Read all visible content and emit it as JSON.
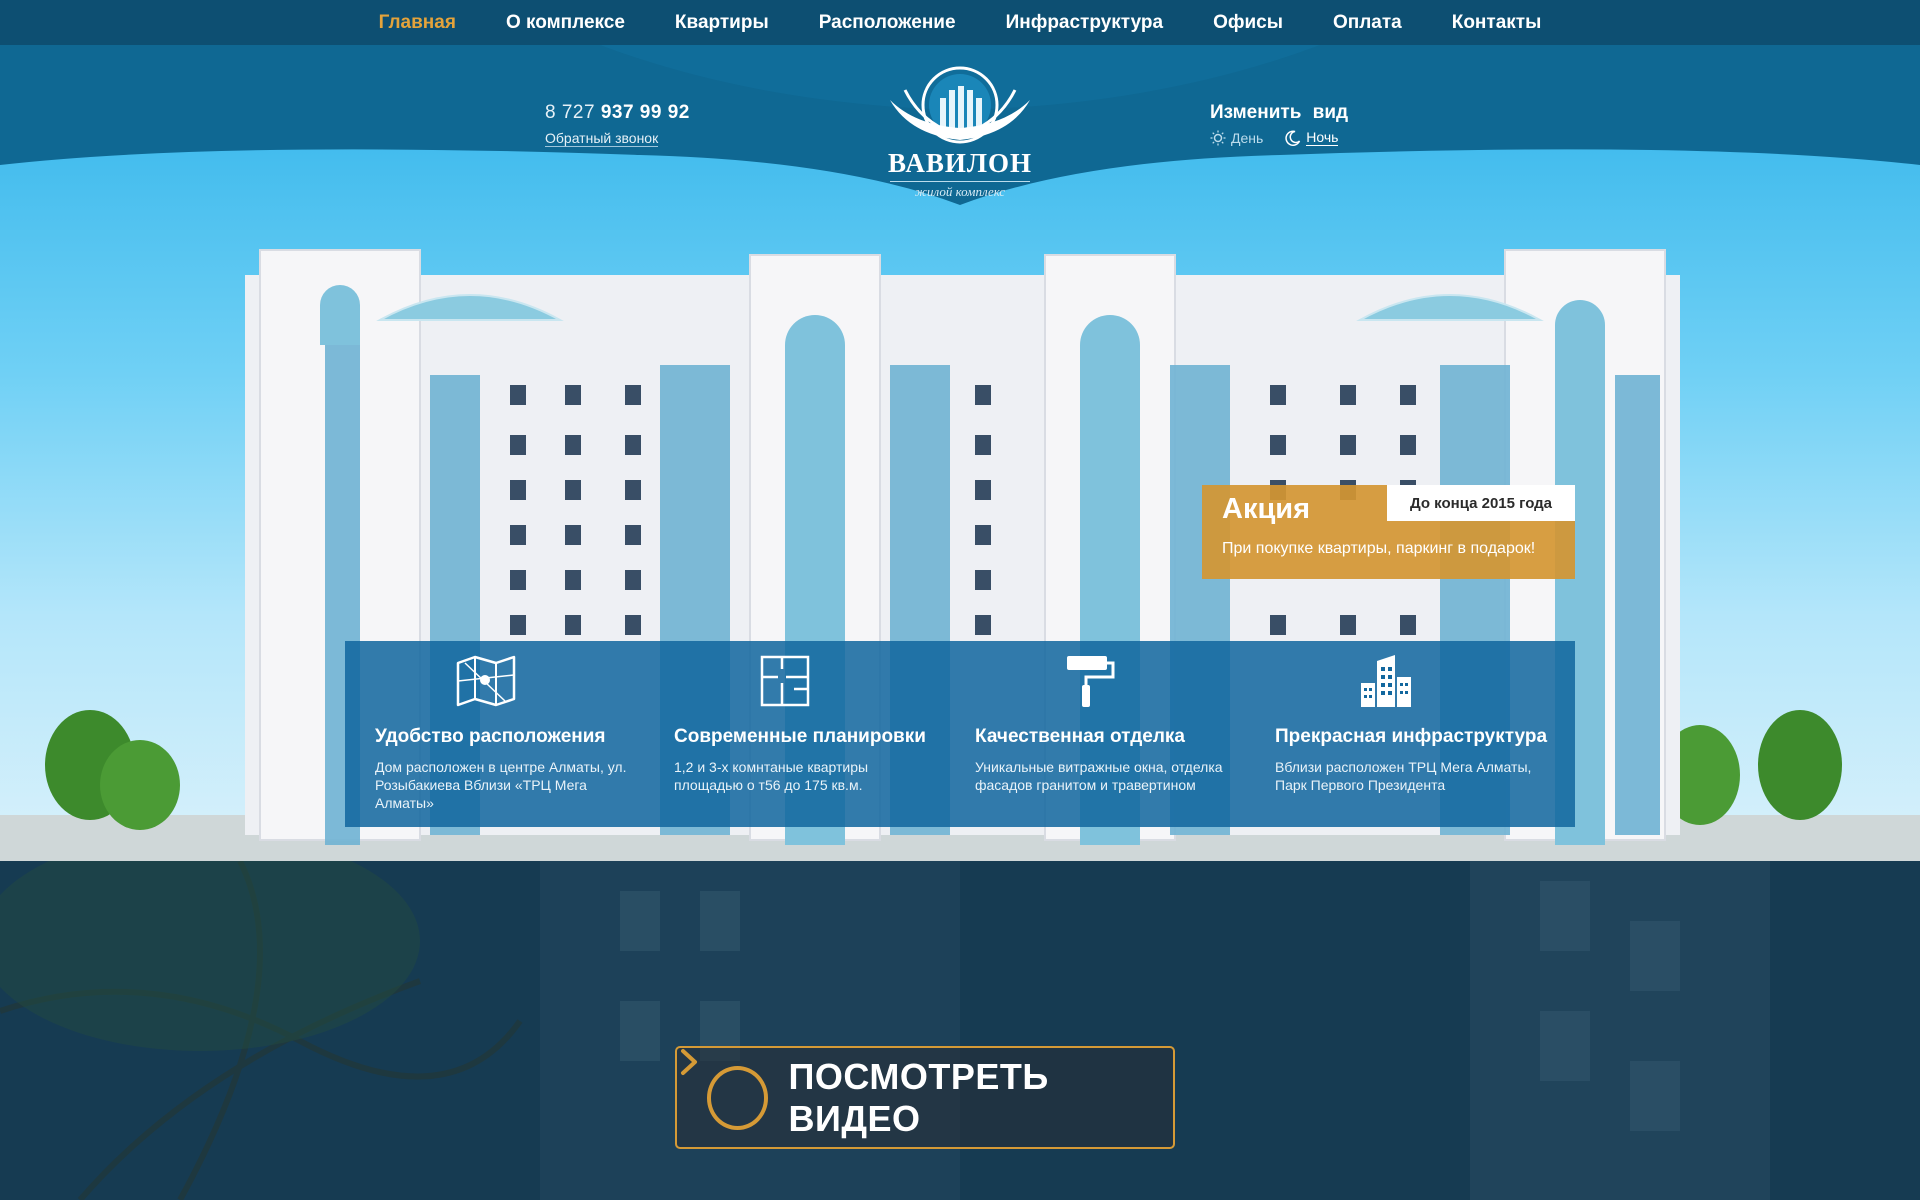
{
  "nav": {
    "items": [
      {
        "label": "Главная",
        "active": true
      },
      {
        "label": "О комплексе"
      },
      {
        "label": "Квартиры"
      },
      {
        "label": "Расположение"
      },
      {
        "label": "Инфраструктура"
      },
      {
        "label": "Офисы"
      },
      {
        "label": "Оплата"
      },
      {
        "label": "Контакты"
      }
    ]
  },
  "header": {
    "phone_prefix": "8 727",
    "phone_number": "937 99 92",
    "callback_label": "Обратный звонок",
    "logo_title": "ВАВИЛОН",
    "logo_subtitle": "жилой комплекс",
    "view_title": "Изменить вид",
    "view_day": "День",
    "view_night": "Ночь",
    "view_selected": "night"
  },
  "promo": {
    "title": "Акция",
    "tag": "До конца 2015 года",
    "text": "При покупке квартиры, паркинг в подарок!"
  },
  "features": [
    {
      "icon": "map-icon",
      "title": "Удобство расположения",
      "text": "Дом расположен в центре Алматы, ул. Розыбакиева Вблизи «ТРЦ Мега Алматы»"
    },
    {
      "icon": "floorplan-icon",
      "title": "Современные планировки",
      "text": "1,2 и 3-х комнтаные квартиры площадью о т56 до 175 кв.м."
    },
    {
      "icon": "paint-roller-icon",
      "title": "Качественная отделка",
      "text": "Уникальные витражные окна, отделка фасадов гранитом и травертином"
    },
    {
      "icon": "city-buildings-icon",
      "title": "Прекрасная инфраструктура",
      "text": "Вблизи расположен ТРЦ Мега Алматы, Парк Первого Президента"
    }
  ],
  "video": {
    "label": "ПОСМОТРЕТЬ ВИДЕО"
  },
  "colors": {
    "nav_bg": "#0d4f72",
    "accent": "#e3a33b",
    "promo_bg": "#d49632",
    "features_bg": "#12679e",
    "video_border": "#d59a36"
  }
}
